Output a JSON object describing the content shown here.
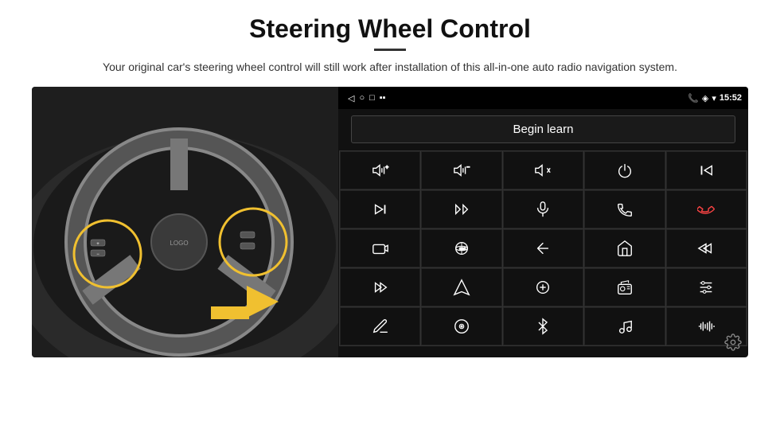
{
  "header": {
    "title": "Steering Wheel Control",
    "subtitle": "Your original car's steering wheel control will still work after installation of this all-in-one auto radio navigation system."
  },
  "statusbar": {
    "time": "15:52",
    "icons": [
      "phone",
      "location",
      "wifi",
      "signal"
    ]
  },
  "begin_learn": {
    "label": "Begin learn"
  },
  "icons": [
    {
      "id": "vol-up",
      "symbol": "vol+"
    },
    {
      "id": "vol-down",
      "symbol": "vol-"
    },
    {
      "id": "mute",
      "symbol": "mute"
    },
    {
      "id": "power",
      "symbol": "power"
    },
    {
      "id": "prev-track",
      "symbol": "prev"
    },
    {
      "id": "skip-next",
      "symbol": "skip-next"
    },
    {
      "id": "shuffle",
      "symbol": "shuffle"
    },
    {
      "id": "mic",
      "symbol": "mic"
    },
    {
      "id": "phone",
      "symbol": "phone"
    },
    {
      "id": "hang-up",
      "symbol": "hang-up"
    },
    {
      "id": "car-cam",
      "symbol": "car-cam"
    },
    {
      "id": "360",
      "symbol": "360"
    },
    {
      "id": "back",
      "symbol": "back"
    },
    {
      "id": "home",
      "symbol": "home"
    },
    {
      "id": "skip-back",
      "symbol": "skip-back"
    },
    {
      "id": "fast-forward",
      "symbol": "ff"
    },
    {
      "id": "navigate",
      "symbol": "nav"
    },
    {
      "id": "eq",
      "symbol": "eq"
    },
    {
      "id": "radio",
      "symbol": "radio"
    },
    {
      "id": "sliders",
      "symbol": "sliders"
    },
    {
      "id": "edit",
      "symbol": "edit"
    },
    {
      "id": "cd",
      "symbol": "cd"
    },
    {
      "id": "bluetooth",
      "symbol": "bt"
    },
    {
      "id": "music",
      "symbol": "music"
    },
    {
      "id": "waveform",
      "symbol": "wave"
    }
  ],
  "settings": {
    "label": "settings"
  }
}
